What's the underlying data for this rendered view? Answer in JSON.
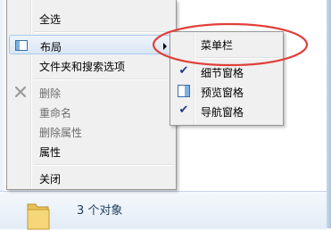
{
  "main_menu": {
    "items": [
      {
        "label": "全选",
        "enabled": true
      },
      {
        "label": "布局",
        "enabled": true,
        "has_submenu": true,
        "highlighted": true,
        "icon": "layout-icon"
      },
      {
        "label": "文件夹和搜索选项",
        "enabled": true
      },
      {
        "label": "删除",
        "enabled": false,
        "icon": "delete-x-icon"
      },
      {
        "label": "重命名",
        "enabled": false
      },
      {
        "label": "删除属性",
        "enabled": false
      },
      {
        "label": "属性",
        "enabled": true
      },
      {
        "label": "关闭",
        "enabled": true
      }
    ]
  },
  "sub_menu": {
    "items": [
      {
        "label": "菜单栏",
        "checked": false,
        "annotated": true
      },
      {
        "label": "细节窗格",
        "checked": true,
        "icon": "checkmark-icon"
      },
      {
        "label": "预览窗格",
        "checked": false,
        "icon": "preview-pane-icon"
      },
      {
        "label": "导航窗格",
        "checked": true,
        "icon": "checkmark-icon"
      }
    ]
  },
  "details_pane": {
    "item_count_text": "3 个对象",
    "icon": "folder-icon"
  },
  "colors": {
    "annotation_ellipse": "#e0403a",
    "menu_background": "#f0f0f0",
    "highlight_border": "#a8c9ef"
  }
}
